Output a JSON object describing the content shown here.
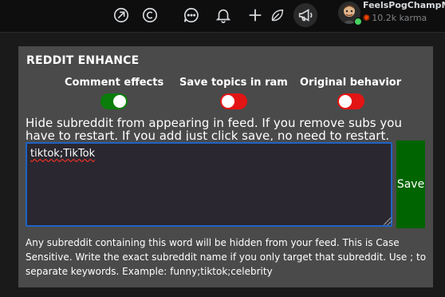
{
  "header": {
    "icons": [
      "popular-icon",
      "copyright-icon",
      "chat-icon",
      "bell-icon",
      "plus-icon",
      "leaf-icon",
      "megaphone-icon"
    ],
    "user": {
      "username": "FeelsPogChampMe",
      "karma": "10.2k karma"
    }
  },
  "panel": {
    "title": "REDDIT ENHANCE",
    "toggles": [
      {
        "label": "Comment effects",
        "state": "on",
        "color": "#0a7d0a"
      },
      {
        "label": "Save topics in ram",
        "state": "off",
        "color": "#e31414"
      },
      {
        "label": "Original behavior",
        "state": "off",
        "color": "#e31414"
      }
    ],
    "description": "Hide subreddit from appearing in feed. If you remove subs you have to restart. If you add just click save, no need to restart.",
    "textarea_value": "tiktok;TikTok",
    "save_label": "Save",
    "help_text": "Any subreddit containing this word will be hidden from your feed. This is Case Sensitive. Write the exact subreddit name if you only target that subreddit. Use ; to separate keywords. Example: funny;tiktok;celebrity"
  },
  "colors": {
    "panel_bg": "#4a4a4a",
    "save_bg": "#006400",
    "textarea_border": "#1f63c6",
    "karma_icon": "#ff4500"
  }
}
